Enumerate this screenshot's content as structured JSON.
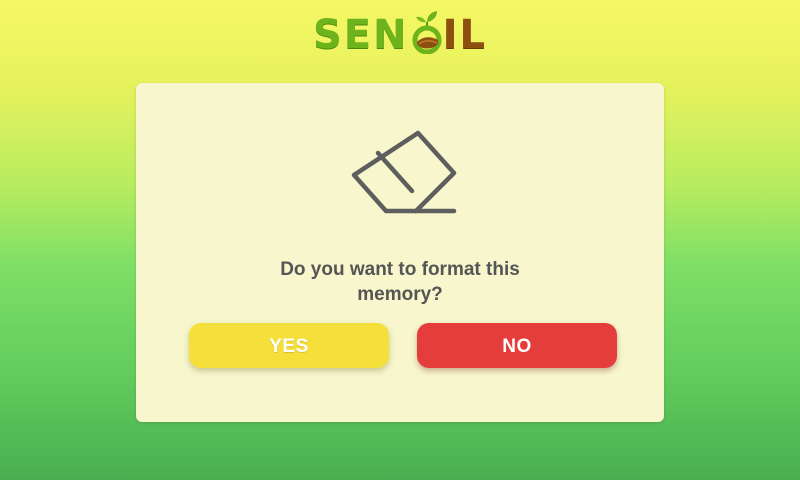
{
  "logo": {
    "part1": "SEN",
    "part2": "IL",
    "full_text": "SENSOIL",
    "icon": "leaf-field-o-icon",
    "colors": {
      "green": "#6db31b",
      "brown": "#8c4f10"
    }
  },
  "dialog": {
    "icon": "eraser-icon",
    "message_line1": "Do you want to format this",
    "message_line2": "memory?",
    "yes_label": "YES",
    "no_label": "NO",
    "colors": {
      "background": "#f7f6cc",
      "yes": "#f5e03b",
      "no": "#e53c3c",
      "text": "#555555"
    }
  }
}
